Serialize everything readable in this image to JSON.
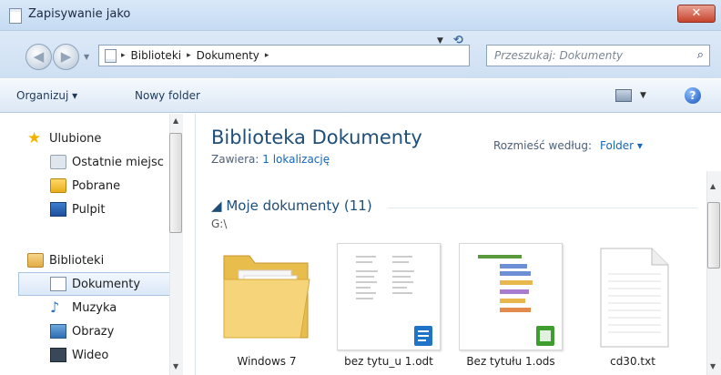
{
  "window": {
    "title": "Zapisywanie jako",
    "close_glyph": "✕"
  },
  "address": {
    "crumbs": [
      "Biblioteki",
      "Dokumenty"
    ],
    "separator": "▸",
    "search_placeholder": "Przeszukaj: Dokumenty"
  },
  "toolbar": {
    "organize_label": "Organizuj ▾",
    "new_folder_label": "Nowy folder",
    "help_glyph": "?"
  },
  "sidebar": {
    "favorites": {
      "label": "Ulubione",
      "items": [
        {
          "label": "Ostatnie miejsc",
          "icon": "recent-places-icon"
        },
        {
          "label": "Pobrane",
          "icon": "downloads-icon"
        },
        {
          "label": "Pulpit",
          "icon": "desktop-icon"
        }
      ]
    },
    "libraries": {
      "label": "Biblioteki",
      "items": [
        {
          "label": "Dokumenty",
          "icon": "documents-icon",
          "selected": true
        },
        {
          "label": "Muzyka",
          "icon": "music-icon"
        },
        {
          "label": "Obrazy",
          "icon": "pictures-icon"
        },
        {
          "label": "Wideo",
          "icon": "video-icon"
        }
      ]
    }
  },
  "content": {
    "title": "Biblioteka Dokumenty",
    "contains_label": "Zawiera:",
    "contains_link": "1 lokalizację",
    "arrange_label": "Rozmieść według:",
    "arrange_value": "Folder ▾",
    "group_header": "Moje dokumenty (11)",
    "group_path": "G:\\",
    "files": [
      {
        "name": "Windows 7",
        "type": "folder"
      },
      {
        "name": "bez tytu_u 1.odt",
        "type": "odt"
      },
      {
        "name": "Bez tytułu 1.ods",
        "type": "ods"
      },
      {
        "name": "cd30.txt",
        "type": "txt"
      }
    ]
  },
  "colors": {
    "accent": "#1e4e79",
    "link": "#1766b7",
    "selection": "#dbe8f7",
    "close_red": "#c7442d"
  }
}
